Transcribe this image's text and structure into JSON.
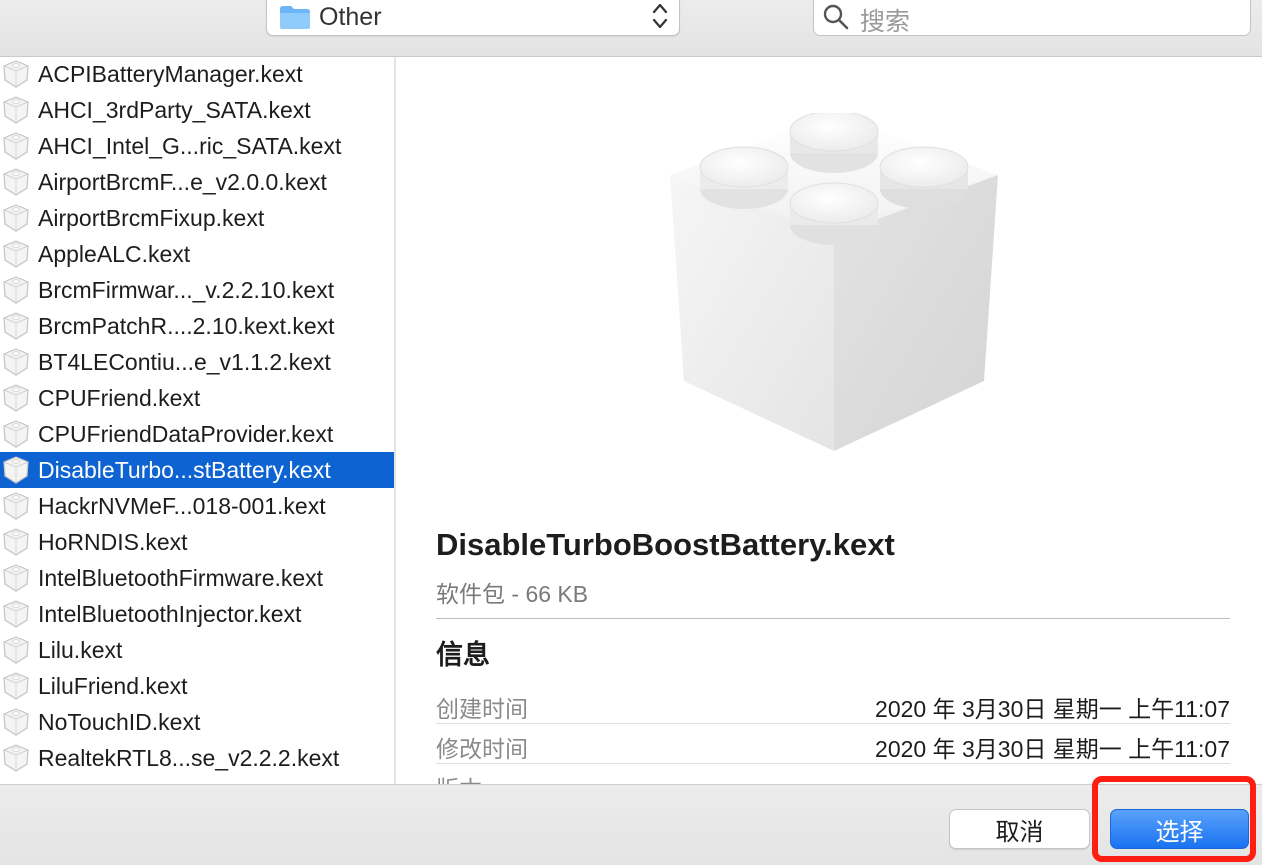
{
  "toolbar": {
    "location": "Other",
    "search_placeholder": "搜索"
  },
  "files": [
    {
      "name": "ACPIBatteryManager.kext",
      "selected": false
    },
    {
      "name": "AHCI_3rdParty_SATA.kext",
      "selected": false
    },
    {
      "name": "AHCI_Intel_G...ric_SATA.kext",
      "selected": false
    },
    {
      "name": "AirportBrcmF...e_v2.0.0.kext",
      "selected": false
    },
    {
      "name": "AirportBrcmFixup.kext",
      "selected": false
    },
    {
      "name": "AppleALC.kext",
      "selected": false
    },
    {
      "name": "BrcmFirmwar..._v.2.2.10.kext",
      "selected": false
    },
    {
      "name": "BrcmPatchR....2.10.kext.kext",
      "selected": false
    },
    {
      "name": "BT4LEContiu...e_v1.1.2.kext",
      "selected": false
    },
    {
      "name": "CPUFriend.kext",
      "selected": false
    },
    {
      "name": "CPUFriendDataProvider.kext",
      "selected": false
    },
    {
      "name": "DisableTurbo...stBattery.kext",
      "selected": true
    },
    {
      "name": "HackrNVMeF...018-001.kext",
      "selected": false
    },
    {
      "name": "HoRNDIS.kext",
      "selected": false
    },
    {
      "name": "IntelBluetoothFirmware.kext",
      "selected": false
    },
    {
      "name": "IntelBluetoothInjector.kext",
      "selected": false
    },
    {
      "name": "Lilu.kext",
      "selected": false
    },
    {
      "name": "LiluFriend.kext",
      "selected": false
    },
    {
      "name": "NoTouchID.kext",
      "selected": false
    },
    {
      "name": "RealtekRTL8...se_v2.2.2.kext",
      "selected": false
    }
  ],
  "preview": {
    "title": "DisableTurboBoostBattery.kext",
    "subtitle": "软件包 - 66 KB",
    "info_heading": "信息",
    "rows": [
      {
        "label": "创建时间",
        "value": "2020 年 3月30日 星期一 上午11:07"
      },
      {
        "label": "修改时间",
        "value": "2020 年 3月30日 星期一 上午11:07"
      },
      {
        "label": "版本",
        "value": ""
      }
    ]
  },
  "buttons": {
    "cancel": "取消",
    "choose": "选择"
  },
  "colors": {
    "selection": "#0e63d3",
    "accent_button": "#1a72f0",
    "highlight": "#ff1f12"
  }
}
